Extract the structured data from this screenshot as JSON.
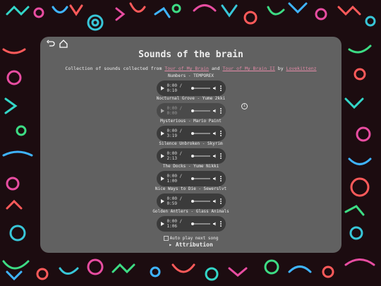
{
  "page": {
    "title": "Sounds of the brain",
    "subtitle_prefix": "Collection of sounds collected from ",
    "link1": "Tour of My Brain",
    "subtitle_mid": " and ",
    "link2": "Tour of My Brain II",
    "subtitle_by": " by ",
    "author": "Lovekittenz"
  },
  "tracks": [
    {
      "name": "Numbers - TEMPOREX",
      "time": "0:00 / 0:10"
    },
    {
      "name": "Nocturnal Grove - Yume 2kki",
      "time": "0:00 / 0:00"
    },
    {
      "name": "Mysterious - Mario Paint",
      "time": "0:00 / 3:19"
    },
    {
      "name": "Silence Unbroken - Skyrim",
      "time": "0:00 / 2:13"
    },
    {
      "name": "The Docks - Yume Nikki",
      "time": "0:00 / 1:00"
    },
    {
      "name": "Nice Ways to Die - Sewerslvt",
      "time": "0:00 / 0:59"
    },
    {
      "name": "Golden Antlers - Glass Animals",
      "time": "0:00 / 1:06"
    }
  ],
  "controls": {
    "autoplay_label": "Auto play next song",
    "attribution_label": "▸ Attribution"
  },
  "icons": {
    "back": "undo-icon",
    "home": "home-icon",
    "info": "info-icon"
  },
  "colors": {
    "panel": "#616161",
    "link": "#e58ba8",
    "background": "#1c0c10"
  }
}
